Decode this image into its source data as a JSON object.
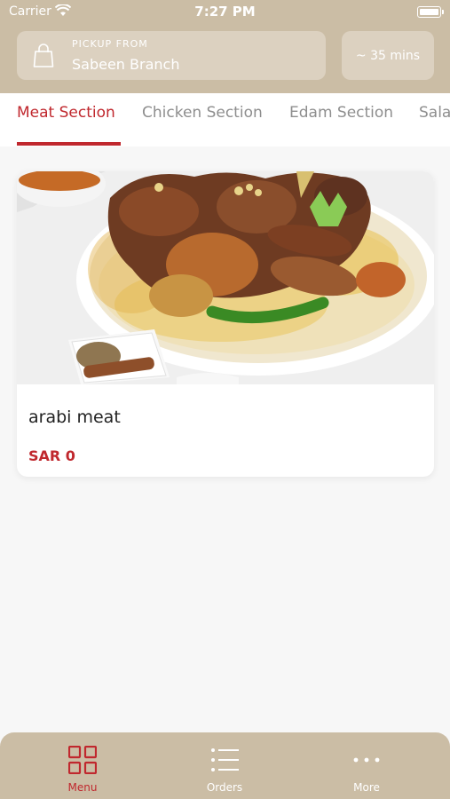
{
  "status_bar": {
    "carrier": "Carrier",
    "time": "7:27 PM"
  },
  "header": {
    "pickup_label": "PICKUP FROM",
    "branch": "Sabeen Branch",
    "eta": "~ 35 mins"
  },
  "categories": [
    {
      "label": "Meat Section",
      "active": true
    },
    {
      "label": "Chicken Section",
      "active": false
    },
    {
      "label": "Edam Section",
      "active": false
    },
    {
      "label": "Sala",
      "active": false
    }
  ],
  "products": [
    {
      "name": "arabi meat",
      "price": "SAR 0",
      "image": "meat-rice-dish"
    }
  ],
  "tab_bar": {
    "items": [
      {
        "label": "Menu",
        "icon": "grid-icon",
        "active": true
      },
      {
        "label": "Orders",
        "icon": "list-icon",
        "active": false
      },
      {
        "label": "More",
        "icon": "more-icon",
        "active": false
      }
    ]
  },
  "colors": {
    "accent": "#c0282e",
    "header_bg": "#cbbda5",
    "chip_bg": "#dcd1c0"
  }
}
